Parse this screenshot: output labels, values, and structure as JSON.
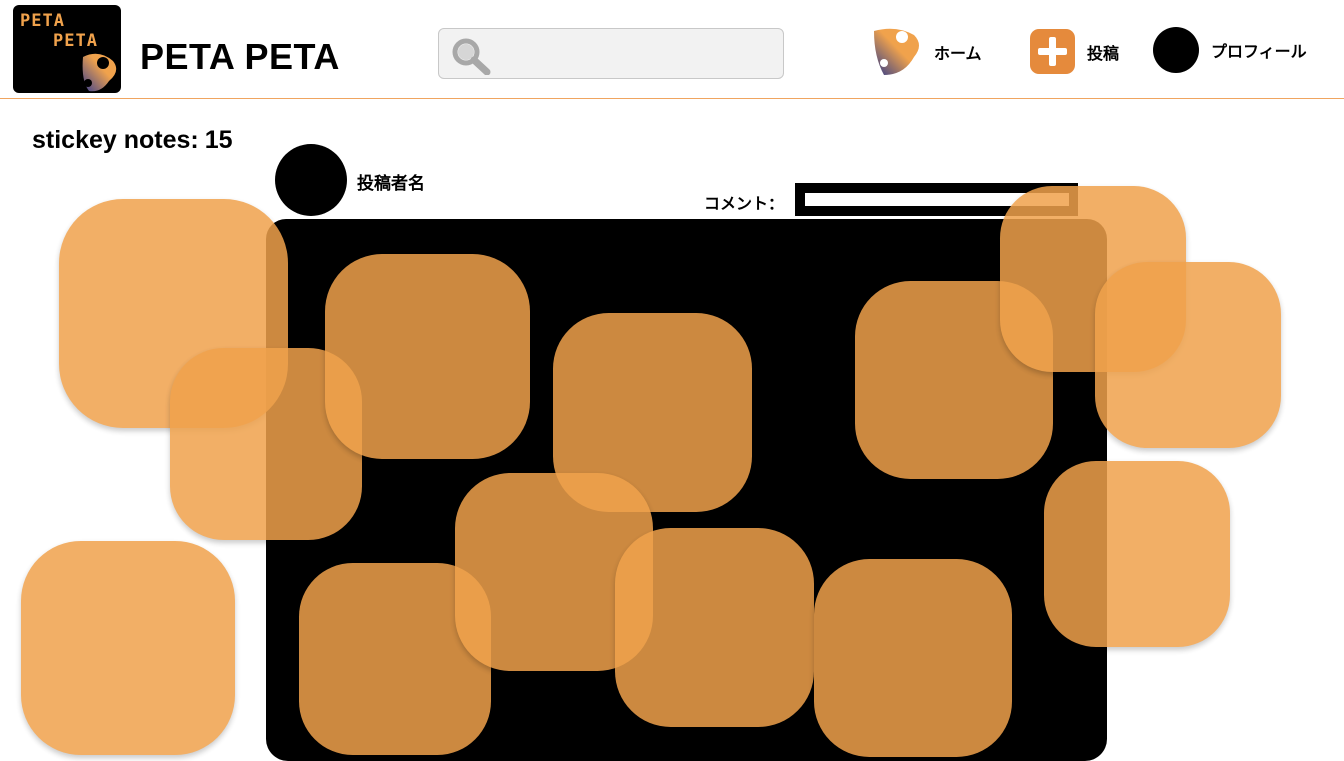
{
  "app": {
    "logo_line1": "PETA",
    "logo_line2": "PETA",
    "title": "PETA PETA"
  },
  "search": {
    "placeholder": "",
    "value": "",
    "icon": "search-icon"
  },
  "nav": {
    "home_label": "ホーム",
    "post_label": "投稿",
    "profile_label": "プロフィール"
  },
  "sticky": {
    "label": "stickey notes:",
    "count": "15"
  },
  "post": {
    "author_name": "投稿者名",
    "comment_label": "コメント：",
    "comment_value": ""
  },
  "colors": {
    "accent": "#f0a24c",
    "accent_dark": "#e58a3c",
    "canvas": "#000000",
    "header_border": "#f0a560"
  }
}
